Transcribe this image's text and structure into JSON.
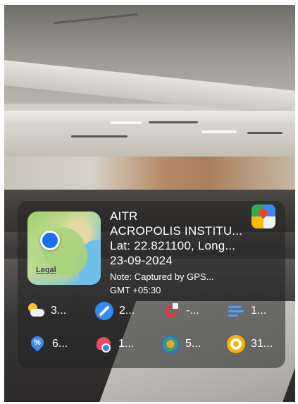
{
  "map": {
    "legal_label": "Legal"
  },
  "location": {
    "name": "AITR",
    "address": "ACROPOLIS INSTITU...",
    "coordinates": "Lat: 22.821100, Long...",
    "date": "23-09-2024",
    "note": "Note: Captured by GPS...",
    "timezone": "GMT +05:30"
  },
  "widgets": {
    "row1": [
      {
        "icon": "weather-cloud-sun-icon",
        "value": "3..."
      },
      {
        "icon": "compass-icon",
        "value": "2..."
      },
      {
        "icon": "magnet-icon",
        "value": "-..."
      },
      {
        "icon": "wind-icon",
        "value": "1..."
      }
    ],
    "row2": [
      {
        "icon": "humidity-icon",
        "value": "6..."
      },
      {
        "icon": "heart-rate-icon",
        "value": "1..."
      },
      {
        "icon": "altitude-globe-icon",
        "value": "5..."
      },
      {
        "icon": "target-icon",
        "value": "31..."
      }
    ]
  },
  "colors": {
    "overlay": "#232323",
    "map_pin": "#1b6ff0",
    "text": "#ffffff"
  }
}
